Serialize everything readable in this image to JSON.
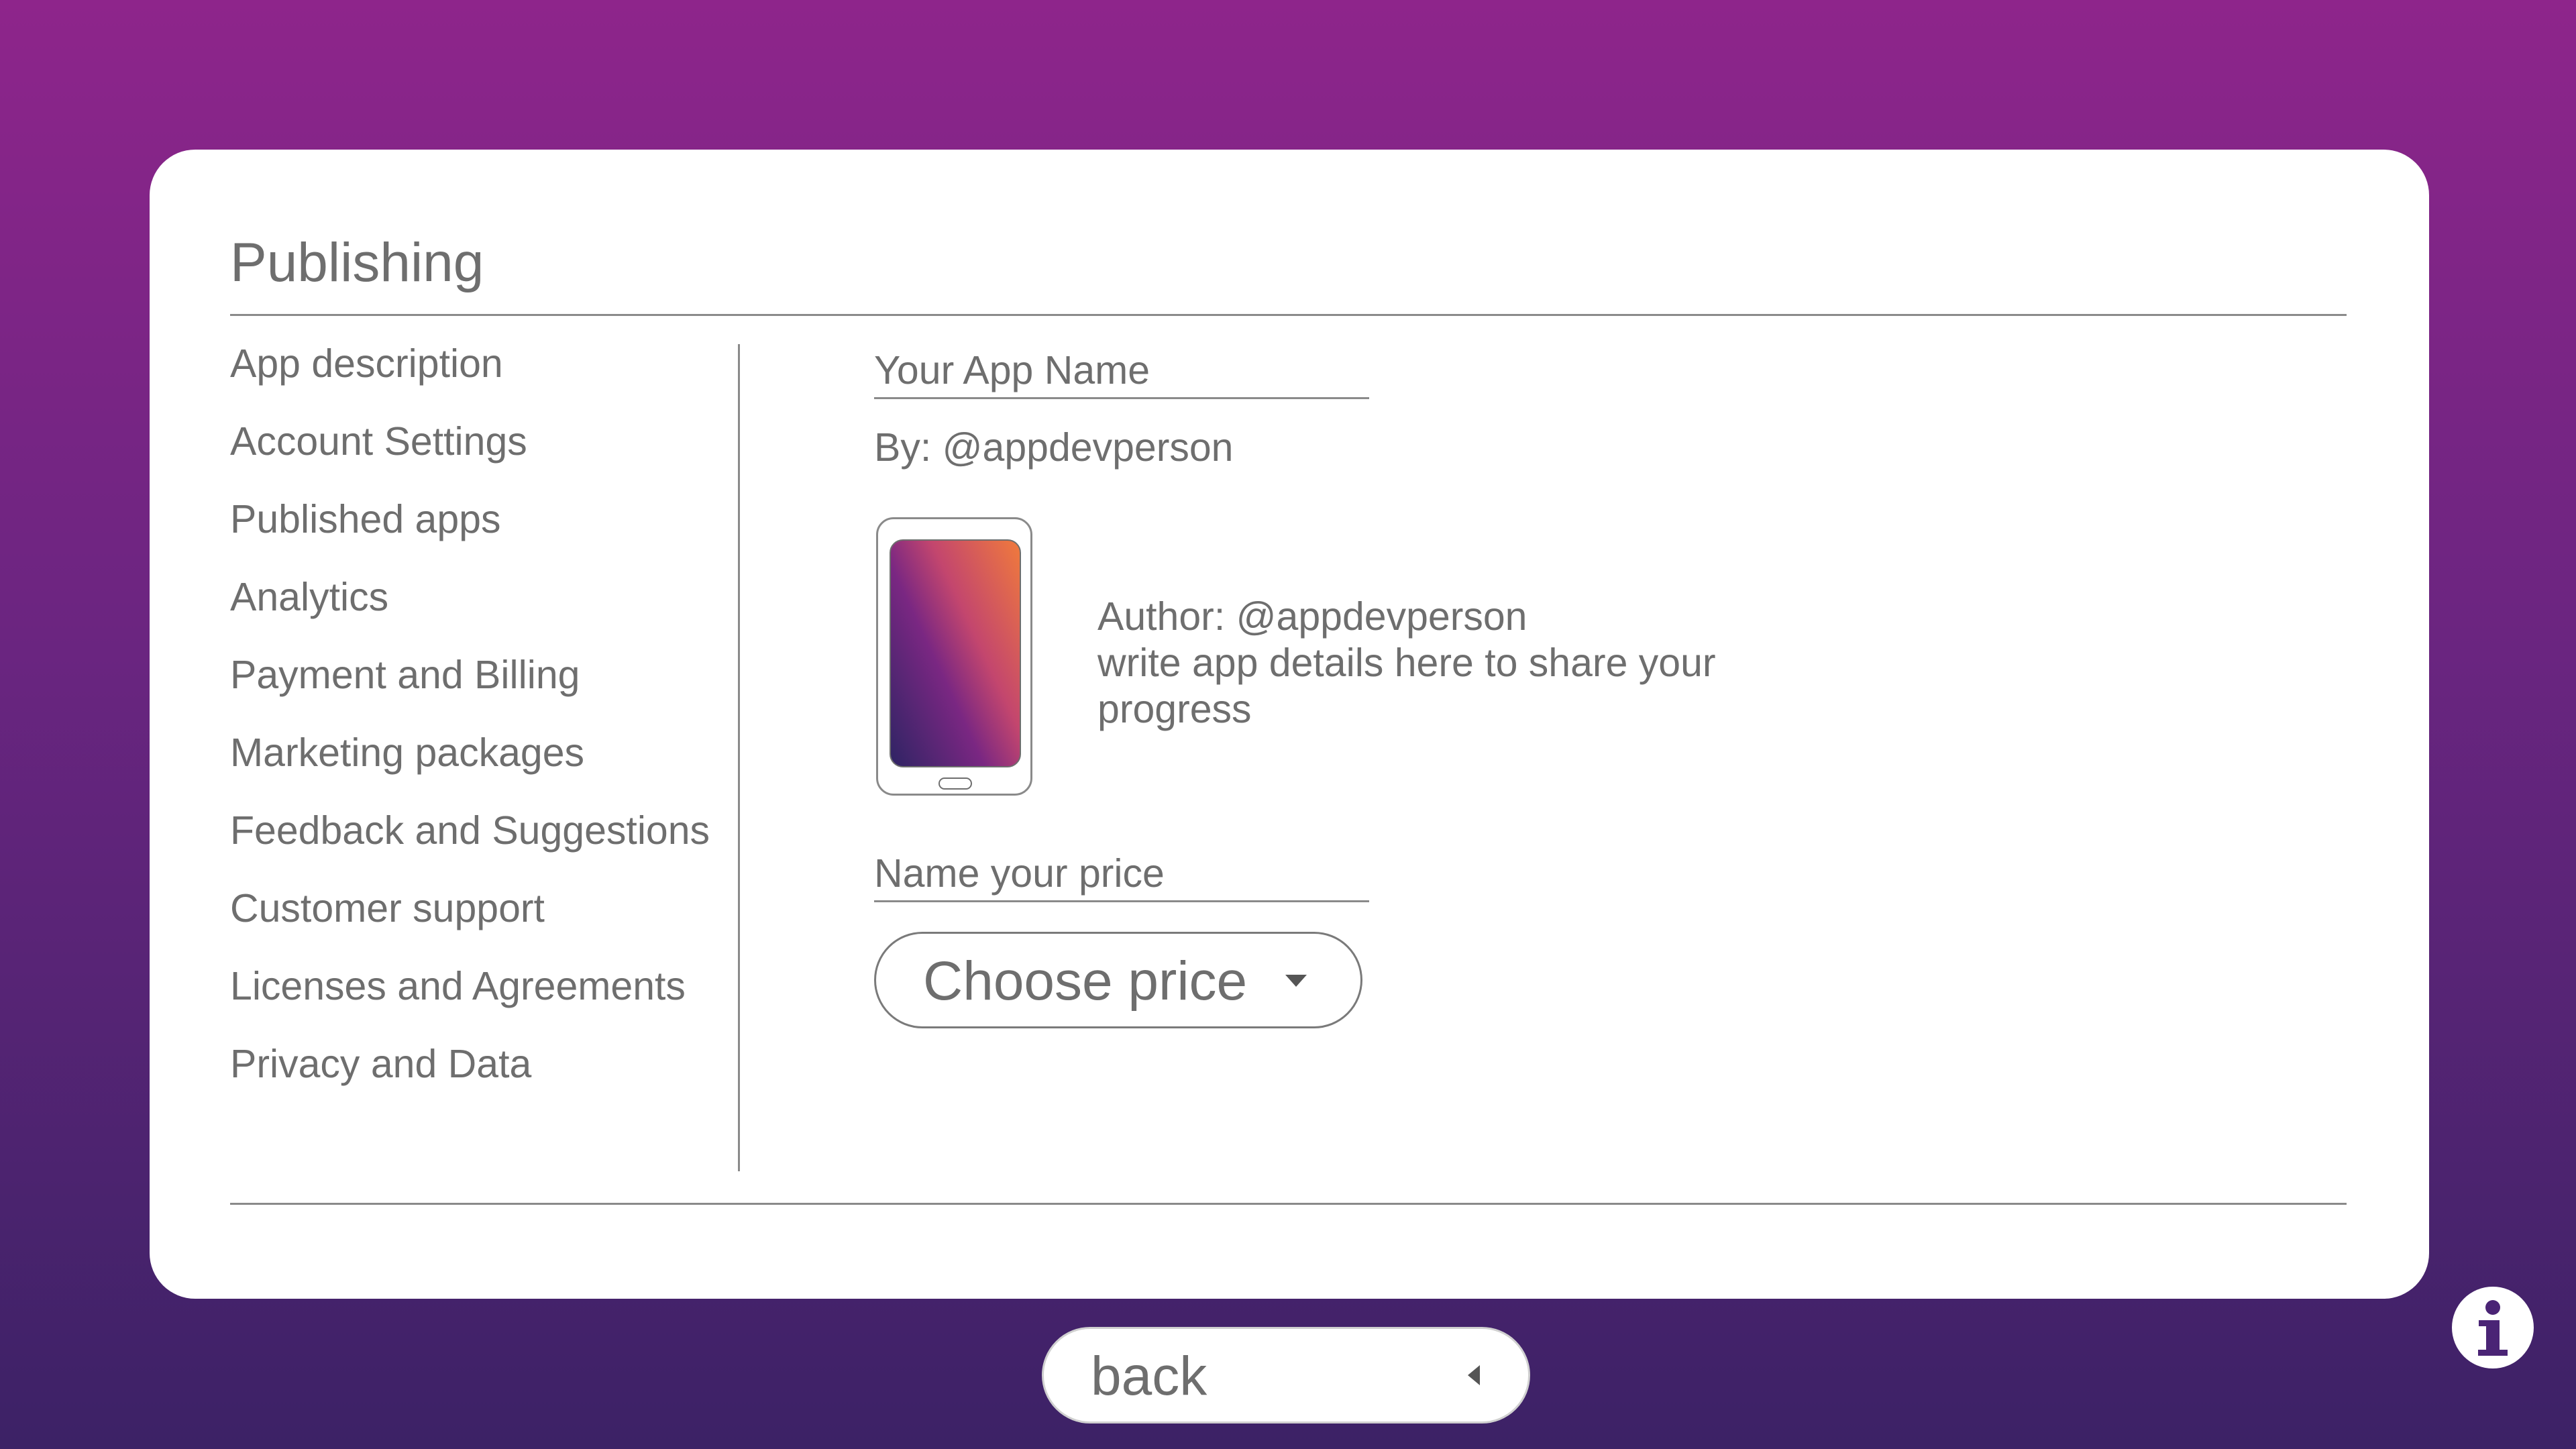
{
  "header": {
    "title": "Publishing"
  },
  "sidebar": {
    "items": [
      {
        "label": "App description"
      },
      {
        "label": "Account Settings"
      },
      {
        "label": "Published apps"
      },
      {
        "label": "Analytics"
      },
      {
        "label": "Payment and Billing"
      },
      {
        "label": "Marketing packages"
      },
      {
        "label": "Feedback and Suggestions"
      },
      {
        "label": "Customer support"
      },
      {
        "label": "Licenses and Agreements"
      },
      {
        "label": "Privacy and Data"
      }
    ]
  },
  "app": {
    "name_label": "Your App Name",
    "by_line": "By: @appdevperson",
    "author": "Author: @appdevperson",
    "details_line1": "write app details here to share your",
    "details_line2": "progress",
    "preview_icon": "phone-icon"
  },
  "pricing": {
    "label": "Name your price",
    "select_value": "Choose price",
    "caret_icon": "chevron-down-icon"
  },
  "footer": {
    "back_label": "back",
    "back_icon": "caret-left-icon",
    "info_icon": "info-icon"
  },
  "colors": {
    "background_top": "#8e258b",
    "background_bottom": "#3c2266",
    "card": "#ffffff",
    "text": "#6e6e6e",
    "info_accent": "#4a2475"
  }
}
